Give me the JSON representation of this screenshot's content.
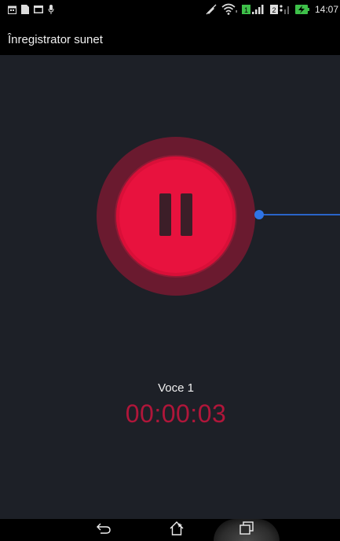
{
  "status_bar": {
    "time": "14:07",
    "sim1_label": "1",
    "sim2_label": "2",
    "icons": [
      "calendar-icon",
      "file-icon",
      "mail-icon",
      "mic-icon",
      "mute-icon",
      "wifi-icon",
      "signal-icon",
      "battery-charging-icon"
    ]
  },
  "app": {
    "title": "Înregistrator sunet"
  },
  "recorder": {
    "state": "recording",
    "name": "Voce 1",
    "elapsed": "00:00:03"
  },
  "navigation": {
    "icons": [
      "back-icon",
      "home-icon",
      "recent-apps-icon"
    ]
  },
  "colors": {
    "background": "#1d2027",
    "accent_red": "#e8123e",
    "ring_dark_red": "#6a1a2f",
    "timer_red": "#b0163a",
    "progress_blue": "#2f74e6",
    "sim_green": "#3ec04a"
  }
}
